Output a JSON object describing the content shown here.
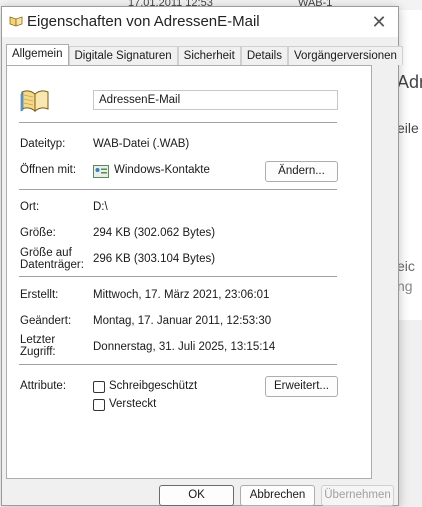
{
  "background": {
    "strip_left": "17.01.2011 12:53",
    "strip_right": "WAB-1",
    "text_1": "Adr",
    "text_2": "eile",
    "text_3": "eic",
    "text_4": "ng"
  },
  "window": {
    "title": "Eigenschaften von AdressenE-Mail",
    "close_glyph": "✕"
  },
  "tabs": [
    {
      "label": "Allgemein",
      "active": true
    },
    {
      "label": "Digitale Signaturen",
      "active": false
    },
    {
      "label": "Sicherheit",
      "active": false
    },
    {
      "label": "Details",
      "active": false
    },
    {
      "label": "Vorgängerversionen",
      "active": false
    }
  ],
  "general": {
    "file_icon": "address-book-icon",
    "file_name": "AdressenE-Mail",
    "type_label": "Dateityp:",
    "type_value": "WAB-Datei (.WAB)",
    "opens_label": "Öffnen mit:",
    "opens_icon": "contacts-app-icon",
    "opens_value": "Windows-Kontakte",
    "change_button": "Ändern...",
    "location_label": "Ort:",
    "location_value": "D:\\",
    "size_label": "Größe:",
    "size_value": "294 KB (302.062 Bytes)",
    "disk_size_label_1": "Größe auf",
    "disk_size_label_2": "Datenträger:",
    "disk_size_value": "296 KB (303.104 Bytes)",
    "created_label": "Erstellt:",
    "created_value": "Mittwoch, 17. März 2021, 23:06:01",
    "modified_label": "Geändert:",
    "modified_value": "Montag, 17. Januar 2011, 12:53:30",
    "accessed_label_1": "Letzter",
    "accessed_label_2": "Zugriff:",
    "accessed_value": "Donnerstag, 31. Juli 2025, 13:15:14",
    "attributes_label": "Attribute:",
    "readonly_label": "Schreibgeschützt",
    "readonly_checked": false,
    "hidden_label": "Versteckt",
    "hidden_checked": false,
    "advanced_button": "Erweitert..."
  },
  "footer": {
    "ok": "OK",
    "cancel": "Abbrechen",
    "apply": "Übernehmen"
  }
}
